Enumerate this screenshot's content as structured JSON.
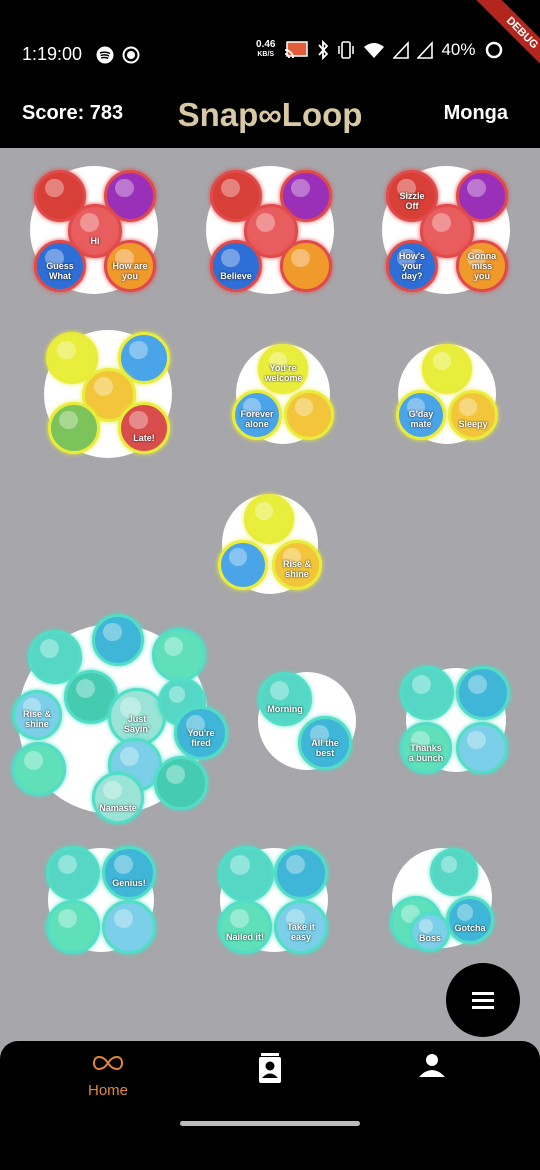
{
  "status_bar": {
    "time": "1:19:00",
    "net_speed_value": "0.46",
    "net_speed_unit": "KB/S",
    "battery": "40%",
    "debug_banner": "DEBUG"
  },
  "app_bar": {
    "score": "Score: 783",
    "title": "Snap∞Loop",
    "username": "Monga"
  },
  "colors": {
    "background": "#a7a6aa",
    "bar": "#000000",
    "title": "#d8c9a4",
    "accent": "#e2873b",
    "glow_red": "#e04a4a",
    "glow_yellow": "#e9ec3a",
    "glow_teal": "#52ddc6"
  },
  "sticker_clusters": [
    {
      "theme": "red",
      "captions": [
        "",
        "",
        "Hi",
        "Guess What",
        "How are you"
      ]
    },
    {
      "theme": "red",
      "captions": [
        "",
        "",
        "",
        "Believe",
        ""
      ]
    },
    {
      "theme": "red",
      "captions": [
        "Sizzle Off",
        "",
        "",
        "How's your day?",
        "Gonna miss you"
      ]
    },
    {
      "theme": "yellow",
      "captions": [
        "",
        "",
        "",
        "",
        "Late!"
      ]
    },
    {
      "theme": "yellow",
      "captions": [
        "You're welcome",
        "Forever alone",
        ""
      ]
    },
    {
      "theme": "yellow",
      "captions": [
        "",
        "G'day mate",
        "Sleepy"
      ]
    },
    {
      "theme": "yellow",
      "captions": [
        "",
        "",
        "Rise & shine"
      ]
    },
    {
      "theme": "teal",
      "captions": [
        "",
        "",
        "",
        "Rise & shine",
        "",
        "Just Sayin'",
        "",
        "You're fired",
        "",
        "",
        "",
        "Namaste"
      ]
    },
    {
      "theme": "teal",
      "captions": [
        "Morning",
        "All the best"
      ]
    },
    {
      "theme": "teal",
      "captions": [
        "",
        "",
        "Thanks a bunch",
        ""
      ]
    },
    {
      "theme": "teal",
      "captions": [
        "",
        "Genius!",
        "",
        ""
      ]
    },
    {
      "theme": "teal",
      "captions": [
        "",
        "",
        "Nailed it!",
        "Take it easy"
      ]
    },
    {
      "theme": "teal",
      "captions": [
        "",
        "Gotcha",
        "",
        "Boss"
      ]
    }
  ],
  "fab": {
    "icon": "menu-icon"
  },
  "bottom_nav": {
    "home_label": "Home",
    "items": [
      "infinity-icon",
      "contacts-icon",
      "person-icon"
    ]
  }
}
